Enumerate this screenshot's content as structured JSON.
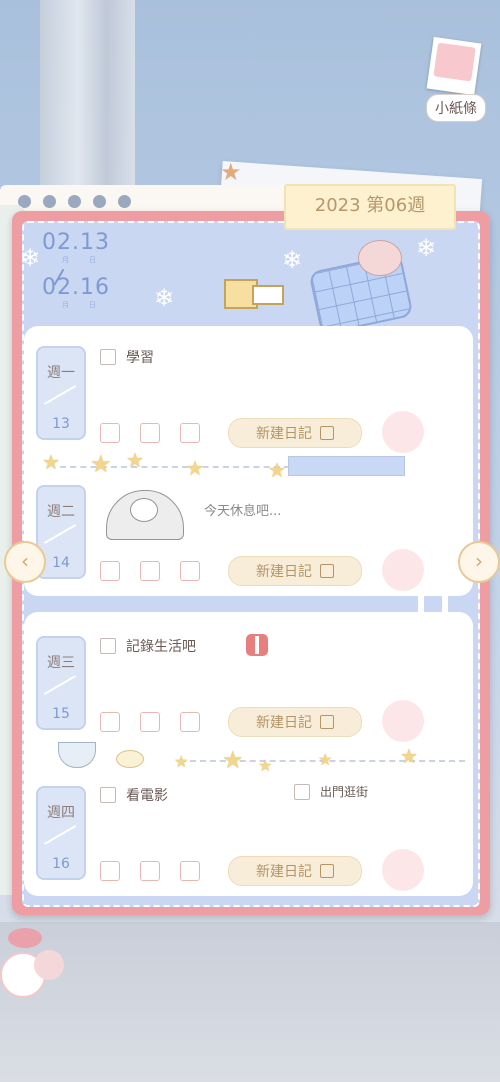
{
  "header": {
    "week_tab": "2023 第06週",
    "start_date": "02.13",
    "end_date": "02.16",
    "month_label": "月",
    "day_label": "日"
  },
  "notes_button": {
    "label": "小紙條"
  },
  "days": [
    {
      "name": "週一",
      "num": "13",
      "tasks": [
        "學習"
      ],
      "new_entry": "新建日記"
    },
    {
      "name": "週二",
      "num": "14",
      "rest_text": "今天休息吧...",
      "new_entry": "新建日記"
    },
    {
      "name": "週三",
      "num": "15",
      "tasks": [
        "記錄生活吧"
      ],
      "new_entry": "新建日記"
    },
    {
      "name": "週四",
      "num": "16",
      "tasks": [
        "看電影",
        "出門逛街"
      ],
      "new_entry": "新建日記"
    }
  ],
  "navigation": {
    "prev": "‹",
    "next": "›"
  },
  "icons": [
    "chevron-left-icon",
    "chevron-right-icon",
    "edit-icon",
    "gift-icon",
    "snowflake-icon",
    "star-icon"
  ],
  "colors": {
    "frame": "#ee9ea2",
    "panel": "#c9d7f2",
    "accent_blue": "#7f9ad3",
    "button_bg": "#f7edd9"
  }
}
